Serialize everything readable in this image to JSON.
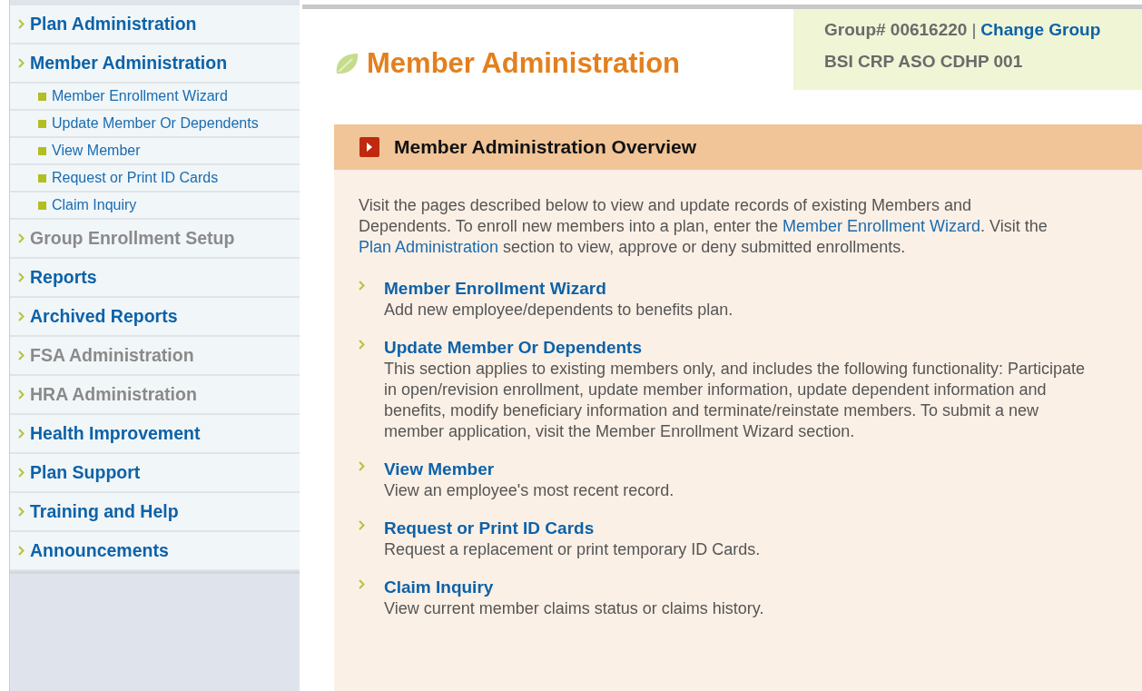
{
  "sidebar": {
    "items": [
      {
        "label": "Plan Administration",
        "disabled": false
      },
      {
        "label": "Member Administration",
        "disabled": false,
        "children": [
          {
            "label": "Member Enrollment Wizard"
          },
          {
            "label": "Update Member Or Dependents"
          },
          {
            "label": "View Member"
          },
          {
            "label": "Request or Print ID Cards"
          },
          {
            "label": "Claim Inquiry"
          }
        ]
      },
      {
        "label": "Group Enrollment Setup",
        "disabled": true
      },
      {
        "label": "Reports",
        "disabled": false
      },
      {
        "label": "Archived Reports",
        "disabled": false
      },
      {
        "label": "FSA Administration",
        "disabled": true
      },
      {
        "label": "HRA Administration",
        "disabled": true
      },
      {
        "label": "Health Improvement",
        "disabled": false
      },
      {
        "label": "Plan Support",
        "disabled": false
      },
      {
        "label": "Training and Help",
        "disabled": false
      },
      {
        "label": "Announcements",
        "disabled": false
      }
    ]
  },
  "group_info": {
    "group_number": "Group# 00616220",
    "separator": "|",
    "change_link": "Change Group",
    "group_name": "BSI CRP ASO CDHP 001"
  },
  "page_title": "Member Administration",
  "overview": {
    "title": "Member Administration Overview",
    "intro": [
      {
        "kind": "text",
        "text": "Visit the pages described below to view and update records of existing Members and Dependents. To enroll new members into a plan, enter the "
      },
      {
        "kind": "link",
        "text": "Member Enrollment Wizard"
      },
      {
        "kind": "text",
        "text": ". Visit the "
      },
      {
        "kind": "link",
        "text": "Plan Administration"
      },
      {
        "kind": "text",
        "text": " section to view, approve or deny submitted enrollments."
      }
    ],
    "sections": [
      {
        "title": "Member Enrollment Wizard",
        "description": "Add new employee/dependents to benefits plan."
      },
      {
        "title": "Update Member Or Dependents",
        "description": "This section applies to existing members only, and includes the following functionality: Participate in open/revision enrollment, update member information, update dependent information and benefits, modify beneficiary information and terminate/reinstate members. To submit a new member application, visit the Member Enrollment Wizard section."
      },
      {
        "title": "View Member",
        "description": "View an employee's most recent record."
      },
      {
        "title": "Request or Print ID Cards",
        "description": "Request a replacement or print temporary ID Cards."
      },
      {
        "title": "Claim Inquiry",
        "description": "View current member claims status or claims history."
      }
    ]
  }
}
